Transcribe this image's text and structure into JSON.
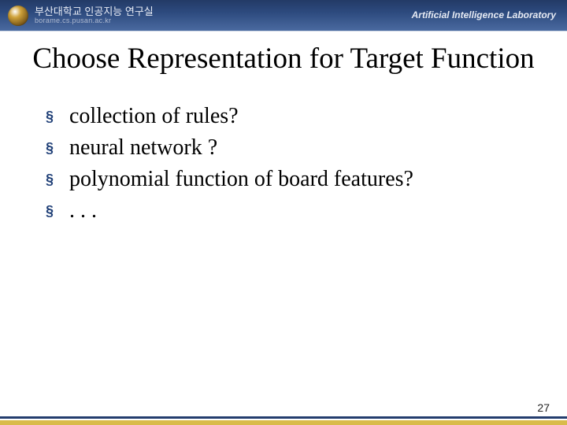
{
  "header": {
    "university_kr": "부산대학교 인공지능 연구실",
    "university_url": "borame.cs.pusan.ac.kr",
    "lab_name": "Artificial Intelligence Laboratory"
  },
  "title": "Choose Representation for Target Function",
  "bullets": [
    "collection of rules?",
    "neural network ?",
    "polynomial function of board features?",
    ". . ."
  ],
  "page_number": "27"
}
